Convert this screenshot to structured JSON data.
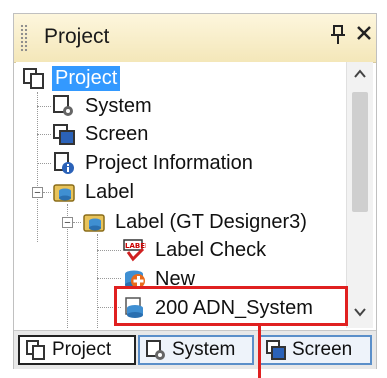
{
  "panel": {
    "title": "Project",
    "pin_glyph": "↑",
    "close_glyph": "✕"
  },
  "tree": {
    "nodes": [
      {
        "label": "Project",
        "icon": "project-icon",
        "selected": true
      },
      {
        "label": "System",
        "icon": "system-icon"
      },
      {
        "label": "Screen",
        "icon": "screen-icon"
      },
      {
        "label": "Project Information",
        "icon": "info-icon"
      },
      {
        "label": "Label",
        "icon": "label-folder-icon",
        "expanded": true
      },
      {
        "label": "Label (GT Designer3)",
        "icon": "label-db-icon",
        "expanded": true
      },
      {
        "label": "Label Check",
        "icon": "label-check-icon"
      },
      {
        "label": "New",
        "icon": "new-label-icon"
      },
      {
        "label": "200 ADN_System",
        "icon": "label-db-icon",
        "highlighted": true
      }
    ]
  },
  "tabs": [
    {
      "label": "Project",
      "icon": "project-icon",
      "active": true
    },
    {
      "label": "System",
      "icon": "system-icon",
      "active": false
    },
    {
      "label": "Screen",
      "icon": "screen-icon",
      "active": false
    }
  ],
  "colors": {
    "title_bg": "#f4e7b9",
    "selection": "#3399ff",
    "annotation": "#e02020"
  }
}
